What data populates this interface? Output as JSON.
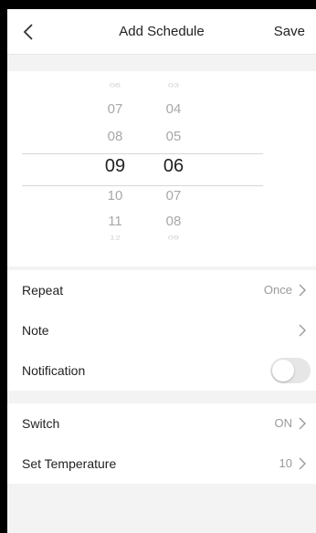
{
  "header": {
    "back_icon": "chevron-left-icon",
    "title": "Add Schedule",
    "save_label": "Save"
  },
  "picker": {
    "hours": [
      "06",
      "07",
      "08",
      "09",
      "10",
      "11",
      "12"
    ],
    "minutes": [
      "03",
      "04",
      "05",
      "06",
      "07",
      "08",
      "09"
    ],
    "selected_hour": "09",
    "selected_minute": "06"
  },
  "settings": {
    "repeat": {
      "label": "Repeat",
      "value": "Once"
    },
    "note": {
      "label": "Note",
      "value": ""
    },
    "notification": {
      "label": "Notification",
      "enabled": false
    },
    "switch": {
      "label": "Switch",
      "value": "ON"
    },
    "set_temperature": {
      "label": "Set Temperature",
      "value": "10"
    }
  },
  "colors": {
    "background": "#f3f3f3",
    "card": "#ffffff",
    "text": "#222222",
    "muted": "#9a9a9a",
    "toggle_off": "#e6e6e6"
  }
}
